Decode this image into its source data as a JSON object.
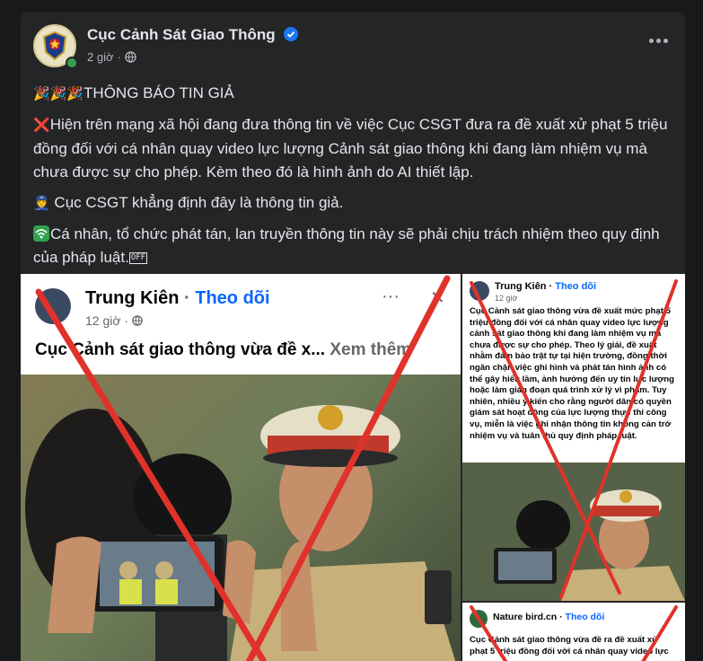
{
  "post": {
    "page_name": "Cục Cảnh Sát Giao Thông",
    "time": "2 giờ",
    "separator": "·",
    "paragraphs": [
      {
        "icon": "🎉🎉🎉",
        "text": "THÔNG BÁO TIN GIẢ"
      },
      {
        "icon": "❌",
        "text": "Hiện trên mạng xã hội đang đưa thông tin về việc Cục CSGT đưa ra đề xuất xử phạt 5 triệu đồng đối với cá nhân quay video lực lượng Cảnh sát giao thông khi đang làm nhiệm vụ mà chưa được sự cho phép. Kèm theo đó là hình ảnh do AI thiết lập."
      },
      {
        "icon": "👮",
        "text": "Cục CSGT khẳng định đây là thông tin giả."
      },
      {
        "icon": "wifi",
        "text": "Cá nhân, tổ chức phát tán, lan truyền thông tin này sẽ phải chịu trách nhiệm theo quy định của pháp luật.",
        "badge": "OFF"
      }
    ]
  },
  "screenshot_main": {
    "name": "Trung Kiên",
    "follow": "Theo dõi",
    "time": "12 giờ",
    "more": "···",
    "close": "✕",
    "headline": "Cục Cảnh sát giao thông vừa đề x...",
    "see_more": "Xem thêm"
  },
  "screenshot_right": {
    "name": "Trung Kiên",
    "follow": "Theo dõi",
    "time": "12 giờ",
    "text": "Cục Cảnh sát giao thông vừa đề xuất mức phạt 5 triệu đồng đối với cá nhân quay video lực lượng cảnh sát giao thông khi đang làm nhiệm vụ mà chưa được sự cho phép. Theo lý giải, đề xuất nhằm đảm bảo trật tự tại hiện trường, đồng thời ngăn chặn việc ghi hình và phát tán hình ảnh có thể gây hiểu lầm, ảnh hưởng đến uy tín lực lượng hoặc làm gián đoạn quá trình xử lý vi phạm. Tuy nhiên, nhiều ý kiến cho rằng người dân có quyền giám sát hoạt động của lực lượng thực thi công vụ, miễn là việc ghi nhận thông tin không cản trở nhiệm vụ và tuân thủ quy định pháp luật."
  },
  "screenshot_bottom": {
    "name": "Nature bird.cn",
    "follow": "Theo dõi",
    "text": "Cục Cảnh sát giao thông vừa đề ra đề xuất xử phạt 5 triệu đồng đối với cá nhân quay video lực"
  },
  "colors": {
    "accent": "#0866ff",
    "cross": "#e0322b",
    "verified": "#1877f2",
    "online": "#31a24c"
  }
}
